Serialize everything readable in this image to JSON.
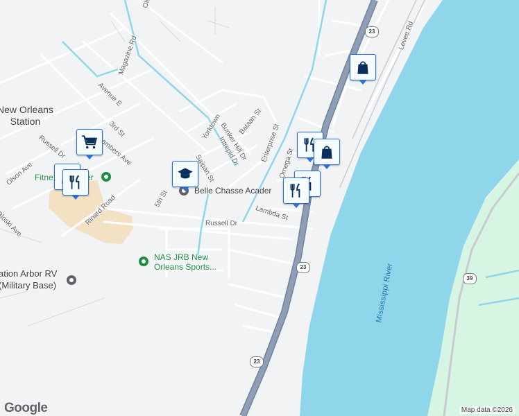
{
  "map": {
    "colors": {
      "land": "#f1f3f4",
      "water": "#8fd6ea",
      "park": "#d6f5e3",
      "highway": "#8e9fb5",
      "highway_edge": "#6f829c",
      "road": "#ffffff",
      "road_edge": "#c8ccd1",
      "canal": "#8fd6ea",
      "military": "#f3e1c4",
      "marker_border": "#2a6fdb",
      "poi_green": "#1e8e3e"
    },
    "place_labels": {
      "new_orleans_station": "New Orleans\nStation",
      "navigation_arbor": "ation Arbor RV\n(Military Base)"
    },
    "street_labels": {
      "olson_top": "Olson",
      "magazine_rd": "Magazine Rd",
      "avenue_e": "Avenue E",
      "third_st": "3rd St",
      "chambers_ave": "hambers Ave",
      "russell_dr_left": "Russell Dr",
      "olson_ave": "Olson Ave",
      "rinard_road": "Rinard Road",
      "fifth_st": "5th St",
      "bloski_ave": "Bloski Ave",
      "yorktown": "Yorktown",
      "bunker_hill_dr": "Bunker Hill Dr",
      "intrepid_dr": "Intrepid Dr",
      "bataan_st": "Bataan St",
      "saipan_st": "Saipan St",
      "enterprise_st": "Enterprise St",
      "omega_st": "Omega St",
      "lambda_st": "Lambda St",
      "russell_dr": "Russell Dr",
      "levee_rd": "Levee Rd"
    },
    "water_labels": {
      "mississippi_river": "Mississippi River"
    },
    "route_shields": [
      "23",
      "23",
      "23",
      "39"
    ],
    "pois": {
      "belle_chasse_academy": "Belle Chasse Acader",
      "fitness_center": "Fitne",
      "fitness_center_tail": "er",
      "nas_jrb": "NAS JRB New\nOrleans Sports..."
    },
    "markers": [
      {
        "type": "shopping-bag",
        "label": "shopping"
      },
      {
        "type": "restaurant",
        "label": "restaurant"
      },
      {
        "type": "shopping-bag",
        "label": "shopping"
      },
      {
        "type": "restaurant",
        "label": "restaurant"
      },
      {
        "type": "restaurant",
        "label": "restaurant"
      },
      {
        "type": "school",
        "label": "school"
      },
      {
        "type": "shopping-cart",
        "label": "grocery"
      },
      {
        "type": "shopping-bag",
        "label": "shopping"
      },
      {
        "type": "restaurant",
        "label": "restaurant"
      }
    ],
    "logo": "Google",
    "attribution": "Map data ©2026"
  }
}
